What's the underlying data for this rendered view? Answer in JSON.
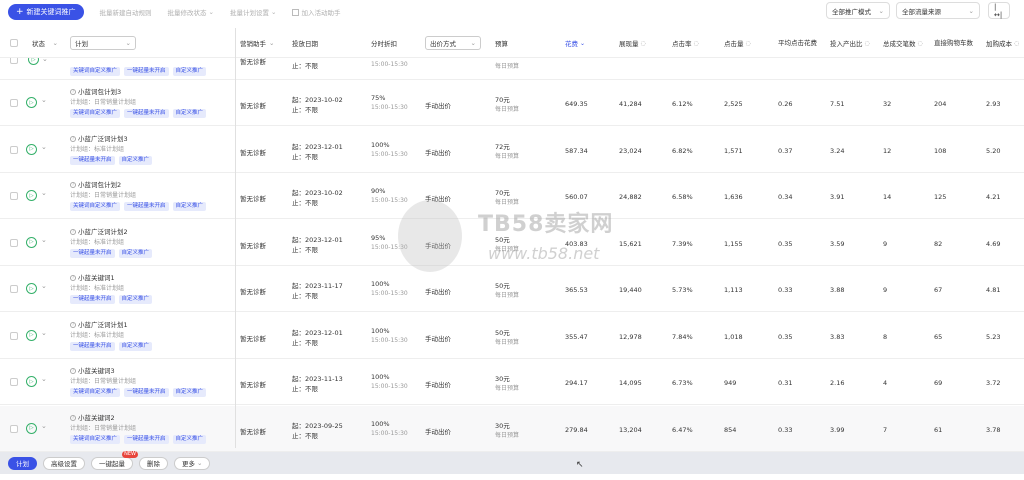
{
  "toolbar": {
    "new_button": "新建关键词推广",
    "links": [
      "批量新建自动规则",
      "批量修改状态",
      "批量计划设置",
      "加入活动助手"
    ],
    "filter_mode": "全部推广模式",
    "filter_source": "全部流量来源"
  },
  "columns": {
    "status": "状态",
    "plan": "计划",
    "assistant": "营销助手",
    "date": "投放日期",
    "timeslot": "分时折扣",
    "bid_method": "出价方式",
    "budget": "预算",
    "spend": "花费",
    "impressions": "展现量",
    "ctr": "点击率",
    "clicks": "点击量",
    "avg_cpc": "平均点击花费",
    "roi": "投入产出比",
    "total_deals": "总成交笔数",
    "direct_cart": "直接购物车数",
    "cart_cost": "加购成本"
  },
  "partial_row": {
    "tags": [
      "关键词自定义推广",
      "一键起量未开启",
      "自定义推广"
    ],
    "assistant": "暂无诊断",
    "date_end": "止：不限",
    "time": "15:00-15:30",
    "budget_sub": "每日预算"
  },
  "rows": [
    {
      "name": "小蓝词包计划3",
      "group": "计划组：日常销量计划组",
      "tags": [
        "关键词自定义推广",
        "一键起量未开启",
        "自定义推广"
      ],
      "assistant": "暂无诊断",
      "start": "起：2023-10-02",
      "end": "止：不限",
      "discount": "75%",
      "time": "15:00-15:30",
      "bid": "手动出价",
      "budget": "70元",
      "budget_sub": "每日预算",
      "spend": "649.35",
      "impressions": "41,284",
      "ctr": "6.12%",
      "clicks": "2,525",
      "cpc": "0.26",
      "roi": "7.51",
      "deals": "32",
      "cart": "204",
      "cart_cost": "2.93"
    },
    {
      "name": "小蓝广泛词计划3",
      "group": "计划组：标准计划组",
      "tags": [
        "一键起量未开启",
        "自定义推广"
      ],
      "assistant": "暂无诊断",
      "start": "起：2023-12-01",
      "end": "止：不限",
      "discount": "100%",
      "time": "15:00-15:30",
      "bid": "手动出价",
      "budget": "72元",
      "budget_sub": "每日预算",
      "spend": "587.34",
      "impressions": "23,024",
      "ctr": "6.82%",
      "clicks": "1,571",
      "cpc": "0.37",
      "roi": "3.24",
      "deals": "12",
      "cart": "108",
      "cart_cost": "5.20"
    },
    {
      "name": "小蓝词包计划2",
      "group": "计划组：日常销量计划组",
      "tags": [
        "关键词自定义推广",
        "一键起量未开启",
        "自定义推广"
      ],
      "assistant": "暂无诊断",
      "start": "起：2023-10-02",
      "end": "止：不限",
      "discount": "90%",
      "time": "15:00-15:30",
      "bid": "手动出价",
      "budget": "70元",
      "budget_sub": "每日预算",
      "spend": "560.07",
      "impressions": "24,882",
      "ctr": "6.58%",
      "clicks": "1,636",
      "cpc": "0.34",
      "roi": "3.91",
      "deals": "14",
      "cart": "125",
      "cart_cost": "4.21"
    },
    {
      "name": "小蓝广泛词计划2",
      "group": "计划组：标准计划组",
      "tags": [
        "一键起量未开启",
        "自定义推广"
      ],
      "assistant": "暂无诊断",
      "start": "起：2023-12-01",
      "end": "止：不限",
      "discount": "95%",
      "time": "15:00-15:30",
      "bid": "手动出价",
      "budget": "50元",
      "budget_sub": "每日预算",
      "spend": "403.83",
      "impressions": "15,621",
      "ctr": "7.39%",
      "clicks": "1,155",
      "cpc": "0.35",
      "roi": "3.59",
      "deals": "9",
      "cart": "82",
      "cart_cost": "4.69"
    },
    {
      "name": "小蓝关键词1",
      "group": "计划组：标准计划组",
      "tags": [
        "一键起量未开启",
        "自定义推广"
      ],
      "assistant": "暂无诊断",
      "start": "起：2023-11-17",
      "end": "止：不限",
      "discount": "100%",
      "time": "15:00-15:30",
      "bid": "手动出价",
      "budget": "50元",
      "budget_sub": "每日预算",
      "spend": "365.53",
      "impressions": "19,440",
      "ctr": "5.73%",
      "clicks": "1,113",
      "cpc": "0.33",
      "roi": "3.88",
      "deals": "9",
      "cart": "67",
      "cart_cost": "4.81"
    },
    {
      "name": "小蓝广泛词计划1",
      "group": "计划组：标准计划组",
      "tags": [
        "一键起量未开启",
        "自定义推广"
      ],
      "assistant": "暂无诊断",
      "start": "起：2023-12-01",
      "end": "止：不限",
      "discount": "100%",
      "time": "15:00-15:30",
      "bid": "手动出价",
      "budget": "50元",
      "budget_sub": "每日预算",
      "spend": "355.47",
      "impressions": "12,978",
      "ctr": "7.84%",
      "clicks": "1,018",
      "cpc": "0.35",
      "roi": "3.83",
      "deals": "8",
      "cart": "65",
      "cart_cost": "5.23"
    },
    {
      "name": "小蓝关键词3",
      "group": "计划组：日常销量计划组",
      "tags": [
        "关键词自定义推广",
        "一键起量未开启",
        "自定义推广"
      ],
      "assistant": "暂无诊断",
      "start": "起：2023-11-13",
      "end": "止：不限",
      "discount": "100%",
      "time": "15:00-15:30",
      "bid": "手动出价",
      "budget": "30元",
      "budget_sub": "每日预算",
      "spend": "294.17",
      "impressions": "14,095",
      "ctr": "6.73%",
      "clicks": "949",
      "cpc": "0.31",
      "roi": "2.16",
      "deals": "4",
      "cart": "69",
      "cart_cost": "3.72"
    },
    {
      "name": "小蓝关键词2",
      "group": "计划组：日常销量计划组",
      "tags": [
        "关键词自定义推广",
        "一键起量未开启",
        "自定义推广"
      ],
      "assistant": "暂无诊断",
      "start": "起：2023-09-25",
      "end": "止：不限",
      "discount": "100%",
      "time": "15:00-15:30",
      "bid": "手动出价",
      "budget": "30元",
      "budget_sub": "每日预算",
      "spend": "279.84",
      "impressions": "13,204",
      "ctr": "6.47%",
      "clicks": "854",
      "cpc": "0.33",
      "roi": "3.99",
      "deals": "7",
      "cart": "61",
      "cart_cost": "3.78"
    }
  ],
  "footer": {
    "buttons": [
      "计划",
      "高级设置",
      "一键起量",
      "删除",
      "更多"
    ],
    "new_badge": "NEW"
  },
  "watermark": {
    "text": "TB58卖家网",
    "url": "www.tb58.net"
  },
  "colors": {
    "accent": "#3a52e6",
    "status_green": "#35b06a"
  }
}
